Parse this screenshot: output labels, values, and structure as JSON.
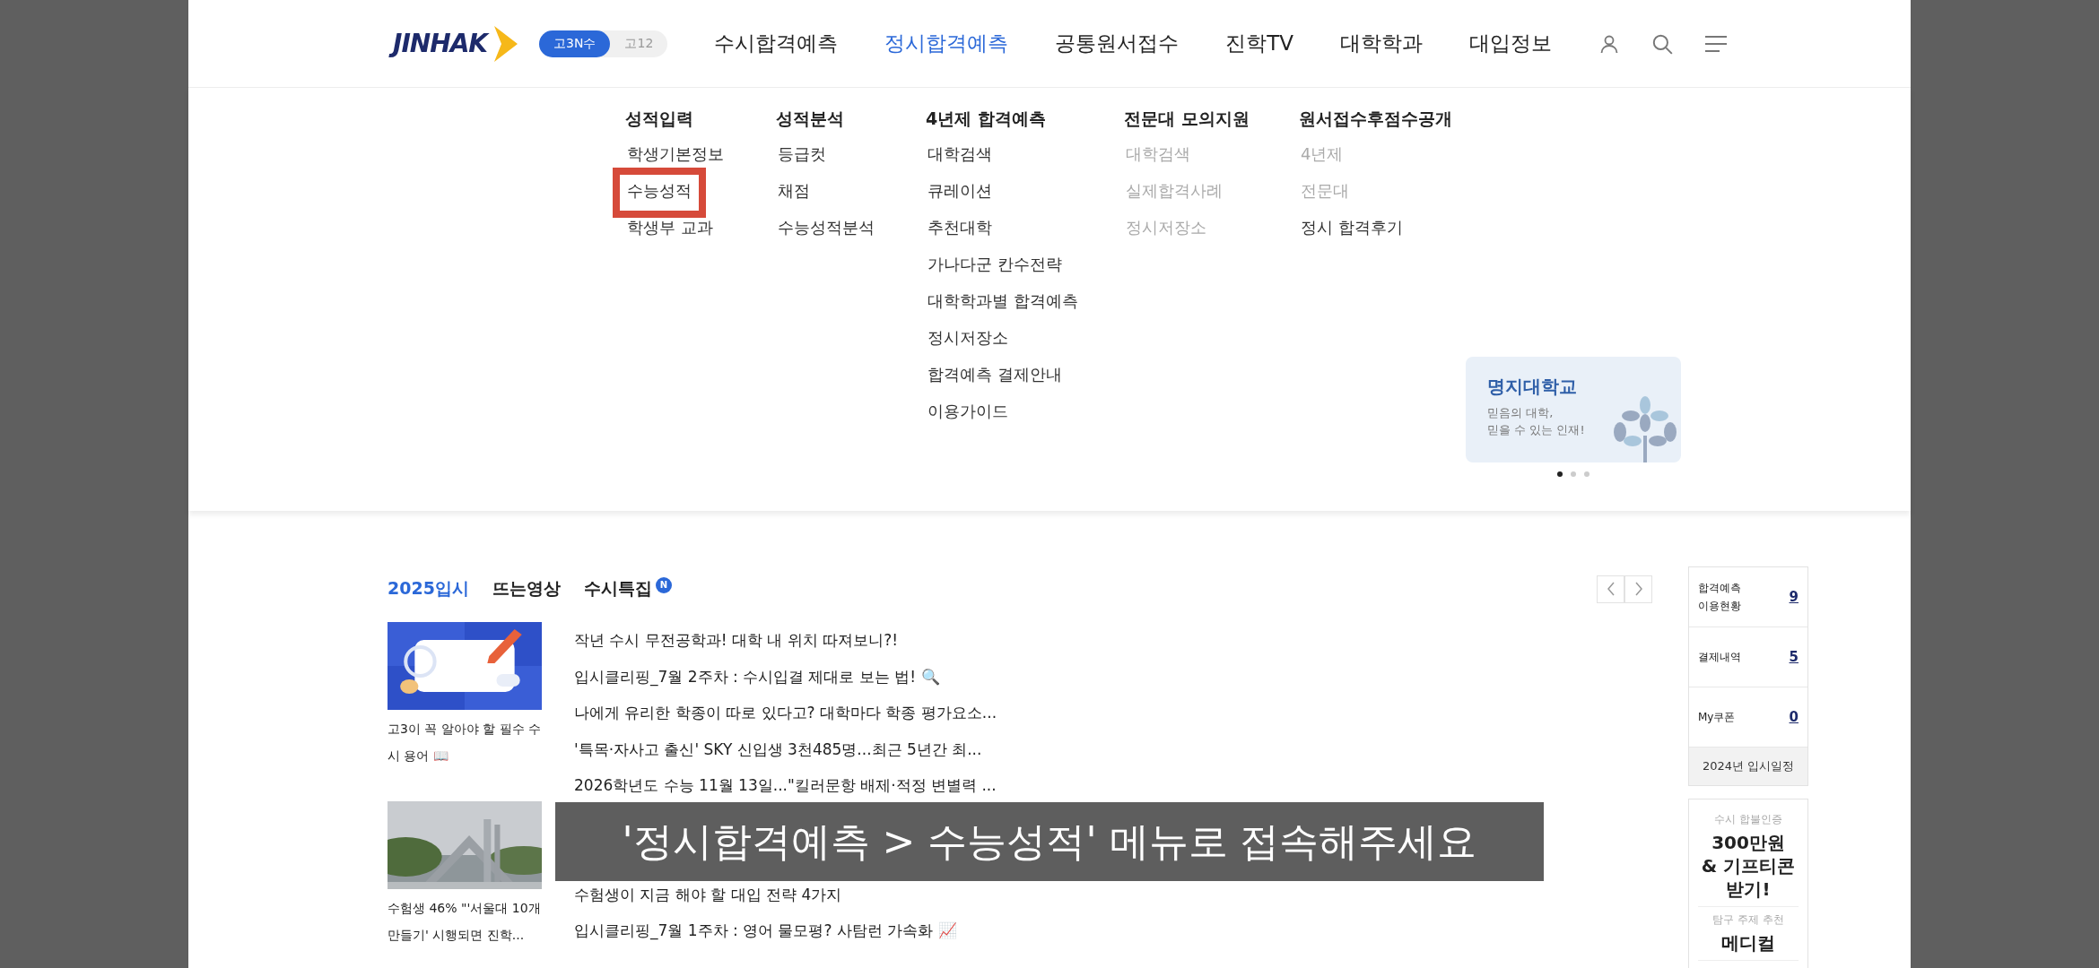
{
  "header": {
    "logo": "JINHAK",
    "grade_toggle": [
      {
        "label": "고3N수",
        "selected": true
      },
      {
        "label": "고12",
        "selected": false
      }
    ],
    "nav": [
      {
        "label": "수시합격예측",
        "selected": false
      },
      {
        "label": "정시합격예측",
        "selected": true
      },
      {
        "label": "공통원서접수",
        "selected": false
      },
      {
        "label": "진학TV",
        "selected": false
      },
      {
        "label": "대학학과",
        "selected": false
      },
      {
        "label": "대입정보",
        "selected": false
      }
    ]
  },
  "mega_menu": {
    "columns": [
      {
        "title": "성적입력",
        "items": [
          {
            "label": "학생기본정보",
            "disabled": false,
            "selected": false
          },
          {
            "label": "수능성적",
            "disabled": false,
            "selected": true
          },
          {
            "label": "학생부 교과",
            "disabled": false,
            "selected": false
          }
        ]
      },
      {
        "title": "성적분석",
        "items": [
          {
            "label": "등급컷",
            "disabled": false,
            "selected": false
          },
          {
            "label": "채점",
            "disabled": false,
            "selected": false
          },
          {
            "label": "수능성적분석",
            "disabled": false,
            "selected": false
          }
        ]
      },
      {
        "title": "4년제 합격예측",
        "items": [
          {
            "label": "대학검색",
            "disabled": false,
            "selected": false
          },
          {
            "label": "큐레이션",
            "disabled": false,
            "selected": false
          },
          {
            "label": "추천대학",
            "disabled": false,
            "selected": false
          },
          {
            "label": "가나다군 칸수전략",
            "disabled": false,
            "selected": false
          },
          {
            "label": "대학학과별 합격예측",
            "disabled": false,
            "selected": false
          },
          {
            "label": "정시저장소",
            "disabled": false,
            "selected": false
          },
          {
            "label": "합격예측 결제안내",
            "disabled": false,
            "selected": false
          },
          {
            "label": "이용가이드",
            "disabled": false,
            "selected": false
          }
        ]
      },
      {
        "title": "전문대 모의지원",
        "items": [
          {
            "label": "대학검색",
            "disabled": true,
            "selected": false
          },
          {
            "label": "실제합격사례",
            "disabled": true,
            "selected": false
          },
          {
            "label": "정시저장소",
            "disabled": true,
            "selected": false
          }
        ]
      },
      {
        "title": "원서접수후점수공개",
        "items": [
          {
            "label": "4년제",
            "disabled": true,
            "selected": false
          },
          {
            "label": "전문대",
            "disabled": true,
            "selected": false
          },
          {
            "label": "정시 합격후기",
            "disabled": false,
            "selected": false
          }
        ]
      }
    ],
    "banner": {
      "title": "명지대학교",
      "lines": [
        "믿음의 대학,",
        "믿을 수 있는 인재!"
      ],
      "dots": [
        {
          "selected": true
        },
        {
          "selected": false
        },
        {
          "selected": false
        }
      ]
    }
  },
  "content_tabs": [
    {
      "label": "2025입시",
      "selected": true
    },
    {
      "label": "뜨는영상",
      "selected": false
    },
    {
      "label": "수시특집",
      "selected": false,
      "badge": "N"
    }
  ],
  "featured": [
    {
      "kind": "picture",
      "caption": "고3이 꼭 알아야 할 필수 수시 용어 📖"
    },
    {
      "kind": "picture",
      "caption": "수험생 46% \"'서울대 10개 만들기' 시행되면 진학..."
    }
  ],
  "news_top": [
    "작년 수시 무전공학과! 대학 내 위치 따져보니?!",
    "입시클리핑_7월 2주차 : 수시입결 제대로 보는 법! 🔍",
    "나에게 유리한 학종이 따로 있다고? 대학마다 학종 평가요소...",
    "'특목·자사고 출신' SKY 신입생 3천485명...최근 5년간 최...",
    "2026학년도 수능 11월 13일...\"킬러문항 배제·적정 변별력 ..."
  ],
  "news_bottom": [
    "수험생이 지금 해야 할 대입 전략 4가지",
    "입시클리핑_7월 1주차 : 영어 물모평? 사탐런 가속화 📈"
  ],
  "sidebar": {
    "stats": [
      {
        "label": "합격예측\n이용현황",
        "value": "9"
      },
      {
        "label": "결제내역",
        "value": "5"
      },
      {
        "label": "My쿠폰",
        "value": "0"
      }
    ],
    "schedule": "2024년 입시일정",
    "promos": [
      {
        "eyebrow": "수시 합불인증",
        "headline": "300만원\n& 기프티콘\n받기!"
      },
      {
        "eyebrow": "탐구 주제 추천",
        "headline": "메디컬"
      }
    ]
  },
  "caption": "'정시합격예측 > 수능성적' 메뉴로 접속해주세요"
}
